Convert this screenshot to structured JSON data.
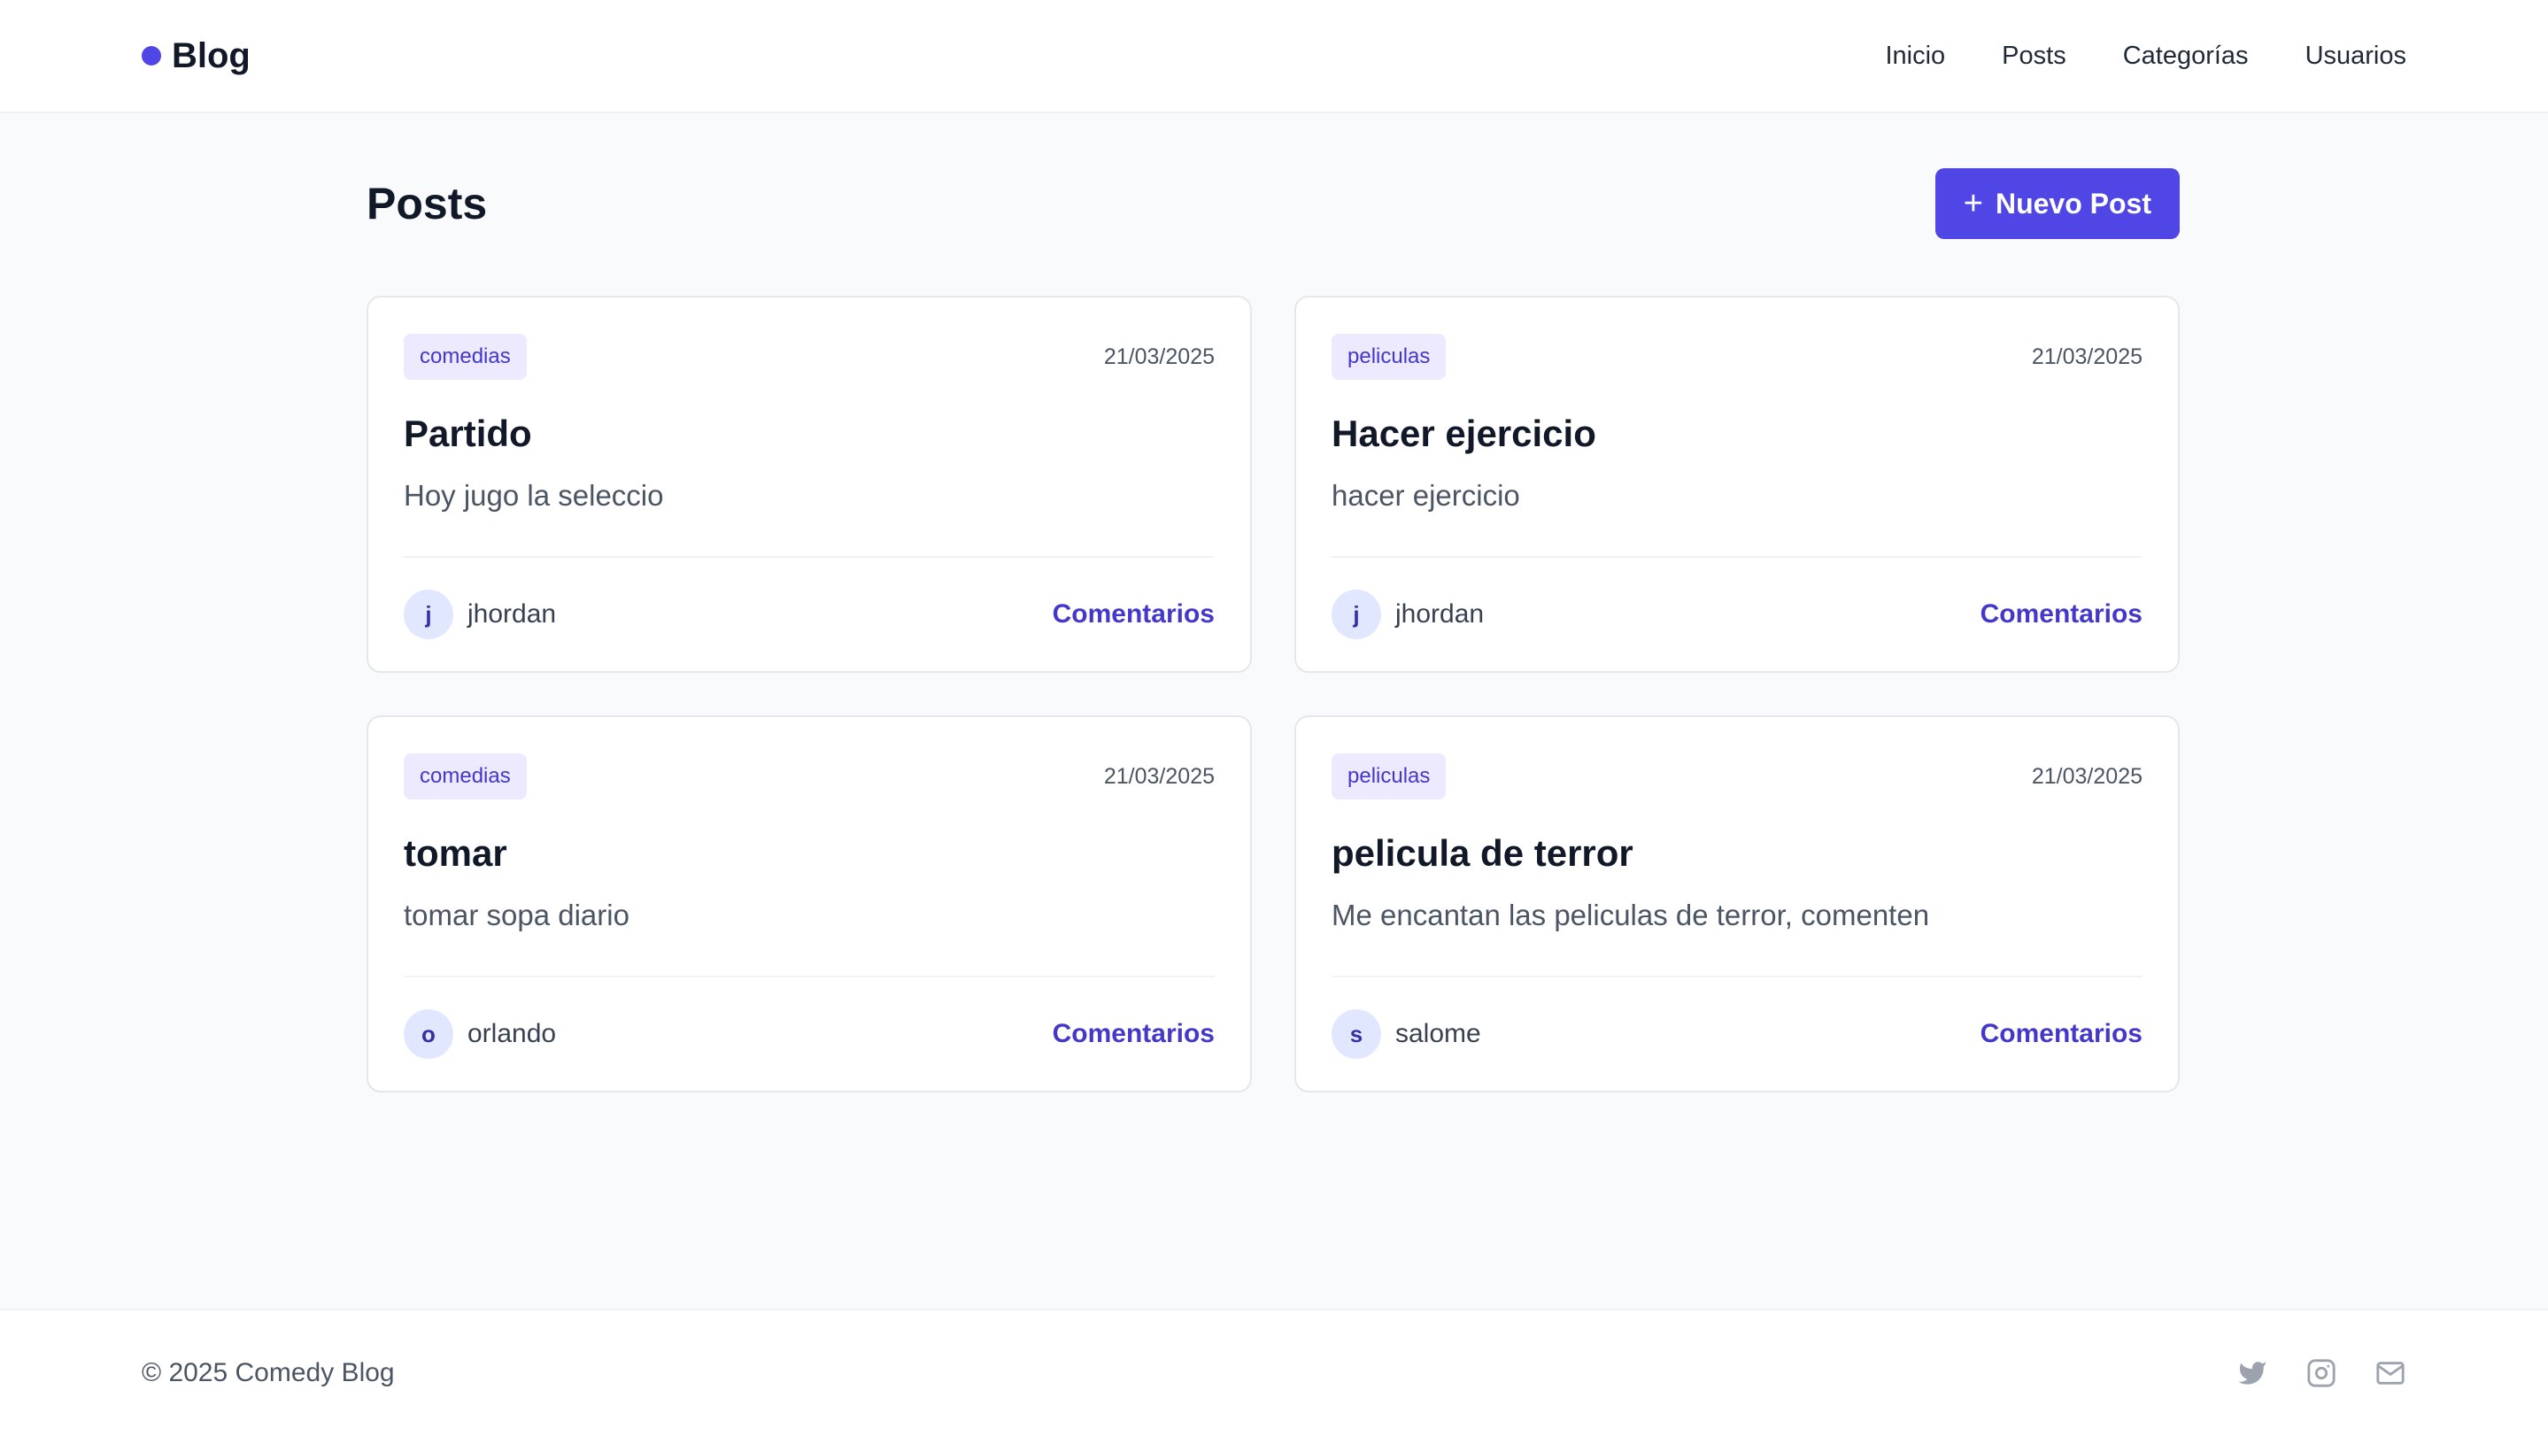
{
  "brand": {
    "name": "Blog",
    "accent": "#4f46e5"
  },
  "nav": {
    "items": [
      {
        "label": "Inicio"
      },
      {
        "label": "Posts"
      },
      {
        "label": "Categorías"
      },
      {
        "label": "Usuarios"
      }
    ]
  },
  "main": {
    "title": "Posts",
    "new_post_label": "Nuevo Post",
    "new_post_icon": "plus-icon"
  },
  "posts": [
    {
      "category": "comedias",
      "date": "21/03/2025",
      "title": "Partido",
      "excerpt": "Hoy jugo la seleccio",
      "author_initial": "j",
      "author": "jhordan",
      "comments_label": "Comentarios"
    },
    {
      "category": "peliculas",
      "date": "21/03/2025",
      "title": "Hacer ejercicio",
      "excerpt": "hacer ejercicio",
      "author_initial": "j",
      "author": "jhordan",
      "comments_label": "Comentarios"
    },
    {
      "category": "comedias",
      "date": "21/03/2025",
      "title": "tomar",
      "excerpt": "tomar sopa diario",
      "author_initial": "o",
      "author": "orlando",
      "comments_label": "Comentarios"
    },
    {
      "category": "peliculas",
      "date": "21/03/2025",
      "title": "pelicula de terror",
      "excerpt": "Me encantan las peliculas de terror, comenten",
      "author_initial": "s",
      "author": "salome",
      "comments_label": "Comentarios"
    }
  ],
  "footer": {
    "copyright": "© 2025 Comedy Blog",
    "social": [
      "twitter-icon",
      "instagram-icon",
      "mail-icon"
    ]
  }
}
